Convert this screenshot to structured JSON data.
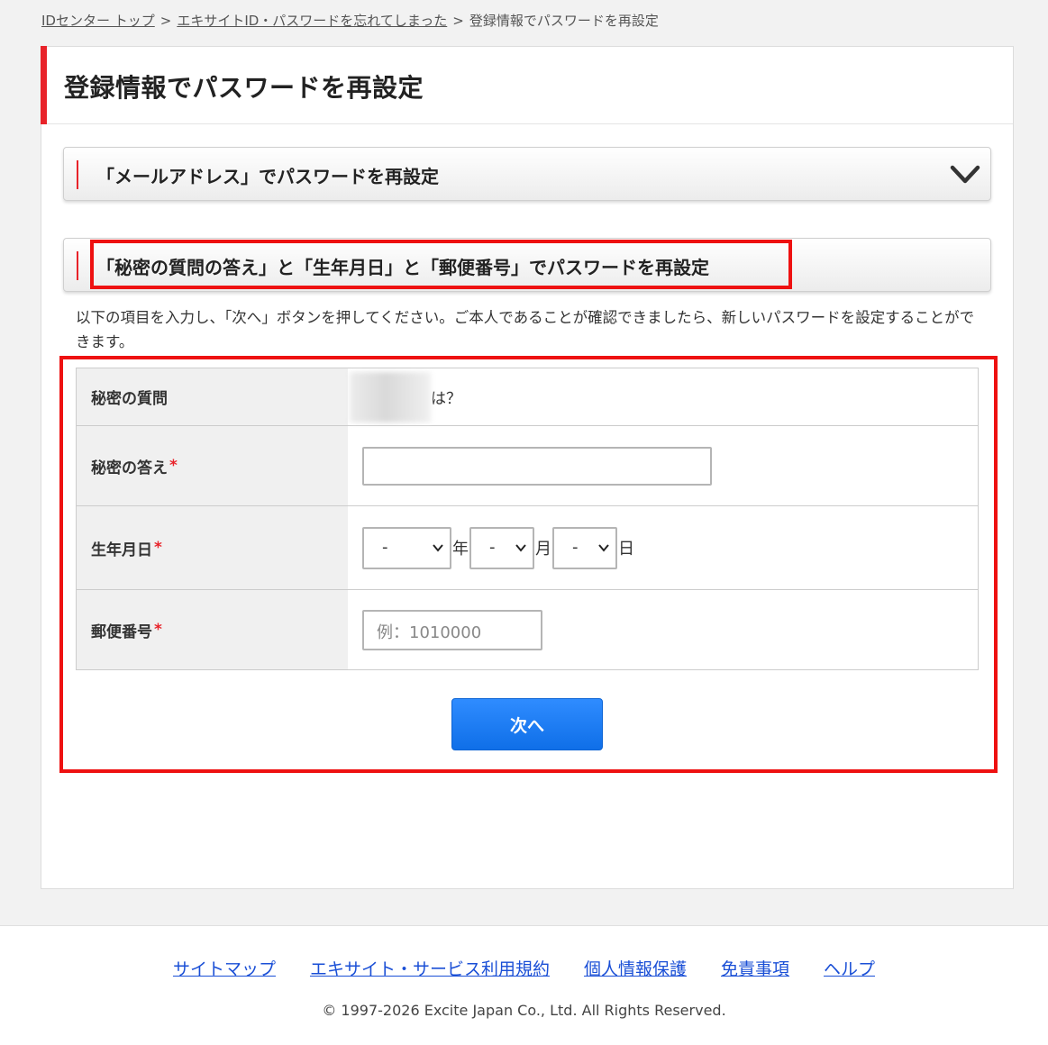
{
  "breadcrumb": {
    "items": [
      "IDセンター トップ",
      "エキサイトID・パスワードを忘れてしまった",
      "登録情報でパスワードを再設定"
    ],
    "separator": ">"
  },
  "page": {
    "title": "登録情報でパスワードを再設定"
  },
  "accordions": [
    {
      "title": "「メールアドレス」でパスワードを再設定",
      "icon": "chevron-down-icon"
    },
    {
      "title": "「秘密の質問の答え」と「生年月日」と「郵便番号」でパスワードを再設定"
    }
  ],
  "description": "以下の項目を入力し、「次へ」ボタンを押してください。ご本人であることが確認できましたら、新しいパスワードを設定することができます。",
  "form": {
    "required_mark": "*",
    "secret_question": {
      "label": "秘密の質問",
      "value_tail": "は？"
    },
    "secret_answer": {
      "label": "秘密の答え",
      "value": ""
    },
    "birthdate": {
      "label": "生年月日",
      "year": {
        "selected": "-",
        "unit": "年"
      },
      "month": {
        "selected": "-",
        "unit": "月"
      },
      "day": {
        "selected": "-",
        "unit": "日"
      }
    },
    "postal_code": {
      "label": "郵便番号",
      "placeholder": "例：1010000"
    },
    "submit_label": "次へ"
  },
  "footer": {
    "links": [
      "サイトマップ",
      "エキサイト・サービス利用規約",
      "個人情報保護",
      "免責事項",
      "ヘルプ"
    ],
    "copyright": "© 1997-2026 Excite Japan Co., Ltd. All Rights Reserved."
  },
  "colors": {
    "accent": "#e8232a",
    "highlight": "#ee1111",
    "button": "#1a7cf5",
    "link": "#1a4fd6"
  }
}
